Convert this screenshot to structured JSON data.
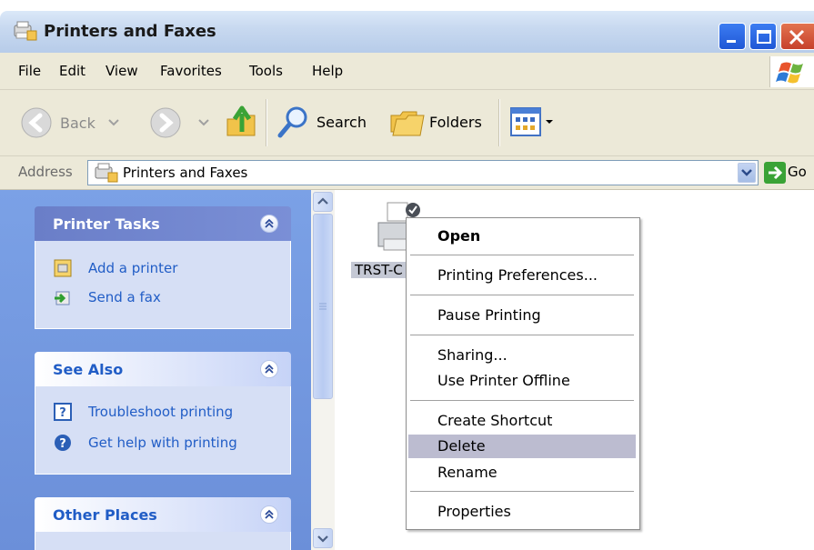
{
  "window": {
    "title": "Printers and Faxes"
  },
  "menubar": {
    "items": [
      {
        "label": "File"
      },
      {
        "label": "Edit"
      },
      {
        "label": "View"
      },
      {
        "label": "Favorites"
      },
      {
        "label": "Tools"
      },
      {
        "label": "Help"
      }
    ]
  },
  "toolbar": {
    "back_label": "Back",
    "search_label": "Search",
    "folders_label": "Folders"
  },
  "address": {
    "label": "Address",
    "value": "Printers and Faxes",
    "go_label": "Go"
  },
  "taskpane": {
    "printer_tasks": {
      "title": "Printer Tasks",
      "items": [
        {
          "label": "Add a printer"
        },
        {
          "label": "Send a fax"
        }
      ]
    },
    "see_also": {
      "title": "See Also",
      "items": [
        {
          "label": "Troubleshoot printing"
        },
        {
          "label": "Get help with printing"
        }
      ]
    },
    "other_places": {
      "title": "Other Places"
    }
  },
  "content": {
    "printer_label": "TRST-C"
  },
  "context_menu": {
    "items": [
      {
        "label": "Open"
      },
      {
        "label": "Printing Preferences..."
      },
      {
        "label": "Pause Printing"
      },
      {
        "label": "Sharing..."
      },
      {
        "label": "Use Printer Offline"
      },
      {
        "label": "Create Shortcut"
      },
      {
        "label": "Delete"
      },
      {
        "label": "Rename"
      },
      {
        "label": "Properties"
      }
    ],
    "highlighted": "Delete"
  },
  "colors": {
    "taskpane_bg": "#7ba1e6",
    "primary_header": "#6a7ec8",
    "link_text": "#215dc6",
    "menu_highlight": "#bcbcd0"
  }
}
